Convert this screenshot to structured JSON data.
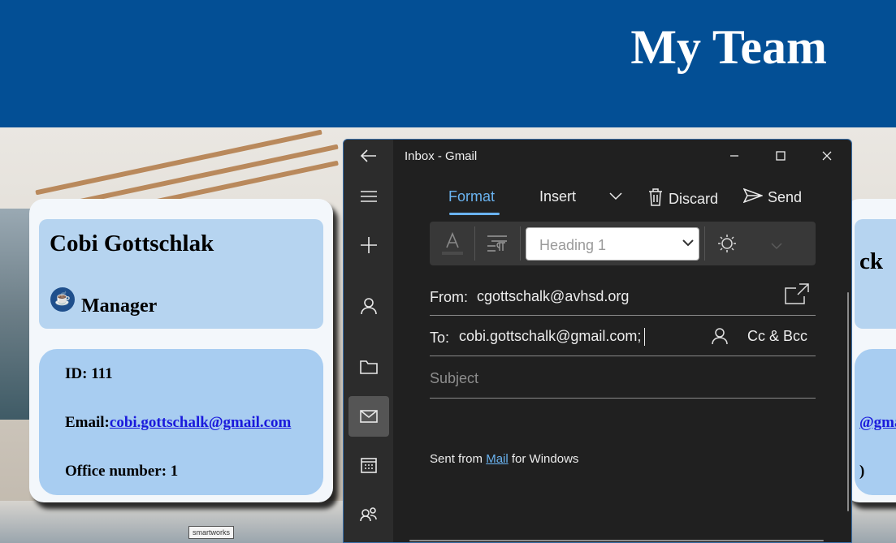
{
  "site": {
    "title": "My Team",
    "brand_sign": "smartworks"
  },
  "card_left": {
    "name": "Cobi Gottschlak",
    "role_icon": "coffee-cup-icon",
    "role": "Manager",
    "id_label": "ID: 111",
    "email_label": "Email:",
    "email": "cobi.gottschalk@gmail.com",
    "office_label": "Office number: 1"
  },
  "card_right": {
    "name_fragment": "ck",
    "email_fragment": "@gmai",
    "office_fragment": ")"
  },
  "mail": {
    "title": "Inbox - Gmail",
    "rail": [
      "back-icon",
      "menu-icon",
      "new-mail-icon",
      "accounts-icon",
      "folders-icon",
      "mail-icon",
      "calendar-icon",
      "people-icon"
    ],
    "toolbar": {
      "format": "Format",
      "insert": "Insert",
      "discard": "Discard",
      "send": "Send"
    },
    "format_bar": {
      "style_value": "Heading 1"
    },
    "from_label": "From:",
    "from_value": "cgottschalk@avhsd.org",
    "to_label": "To:",
    "to_value": "cobi.gottschalk@gmail.com;",
    "cc_bcc": "Cc & Bcc",
    "subject_placeholder": "Subject",
    "signature_prefix": "Sent from ",
    "signature_link": "Mail",
    "signature_suffix": " for Windows"
  }
}
